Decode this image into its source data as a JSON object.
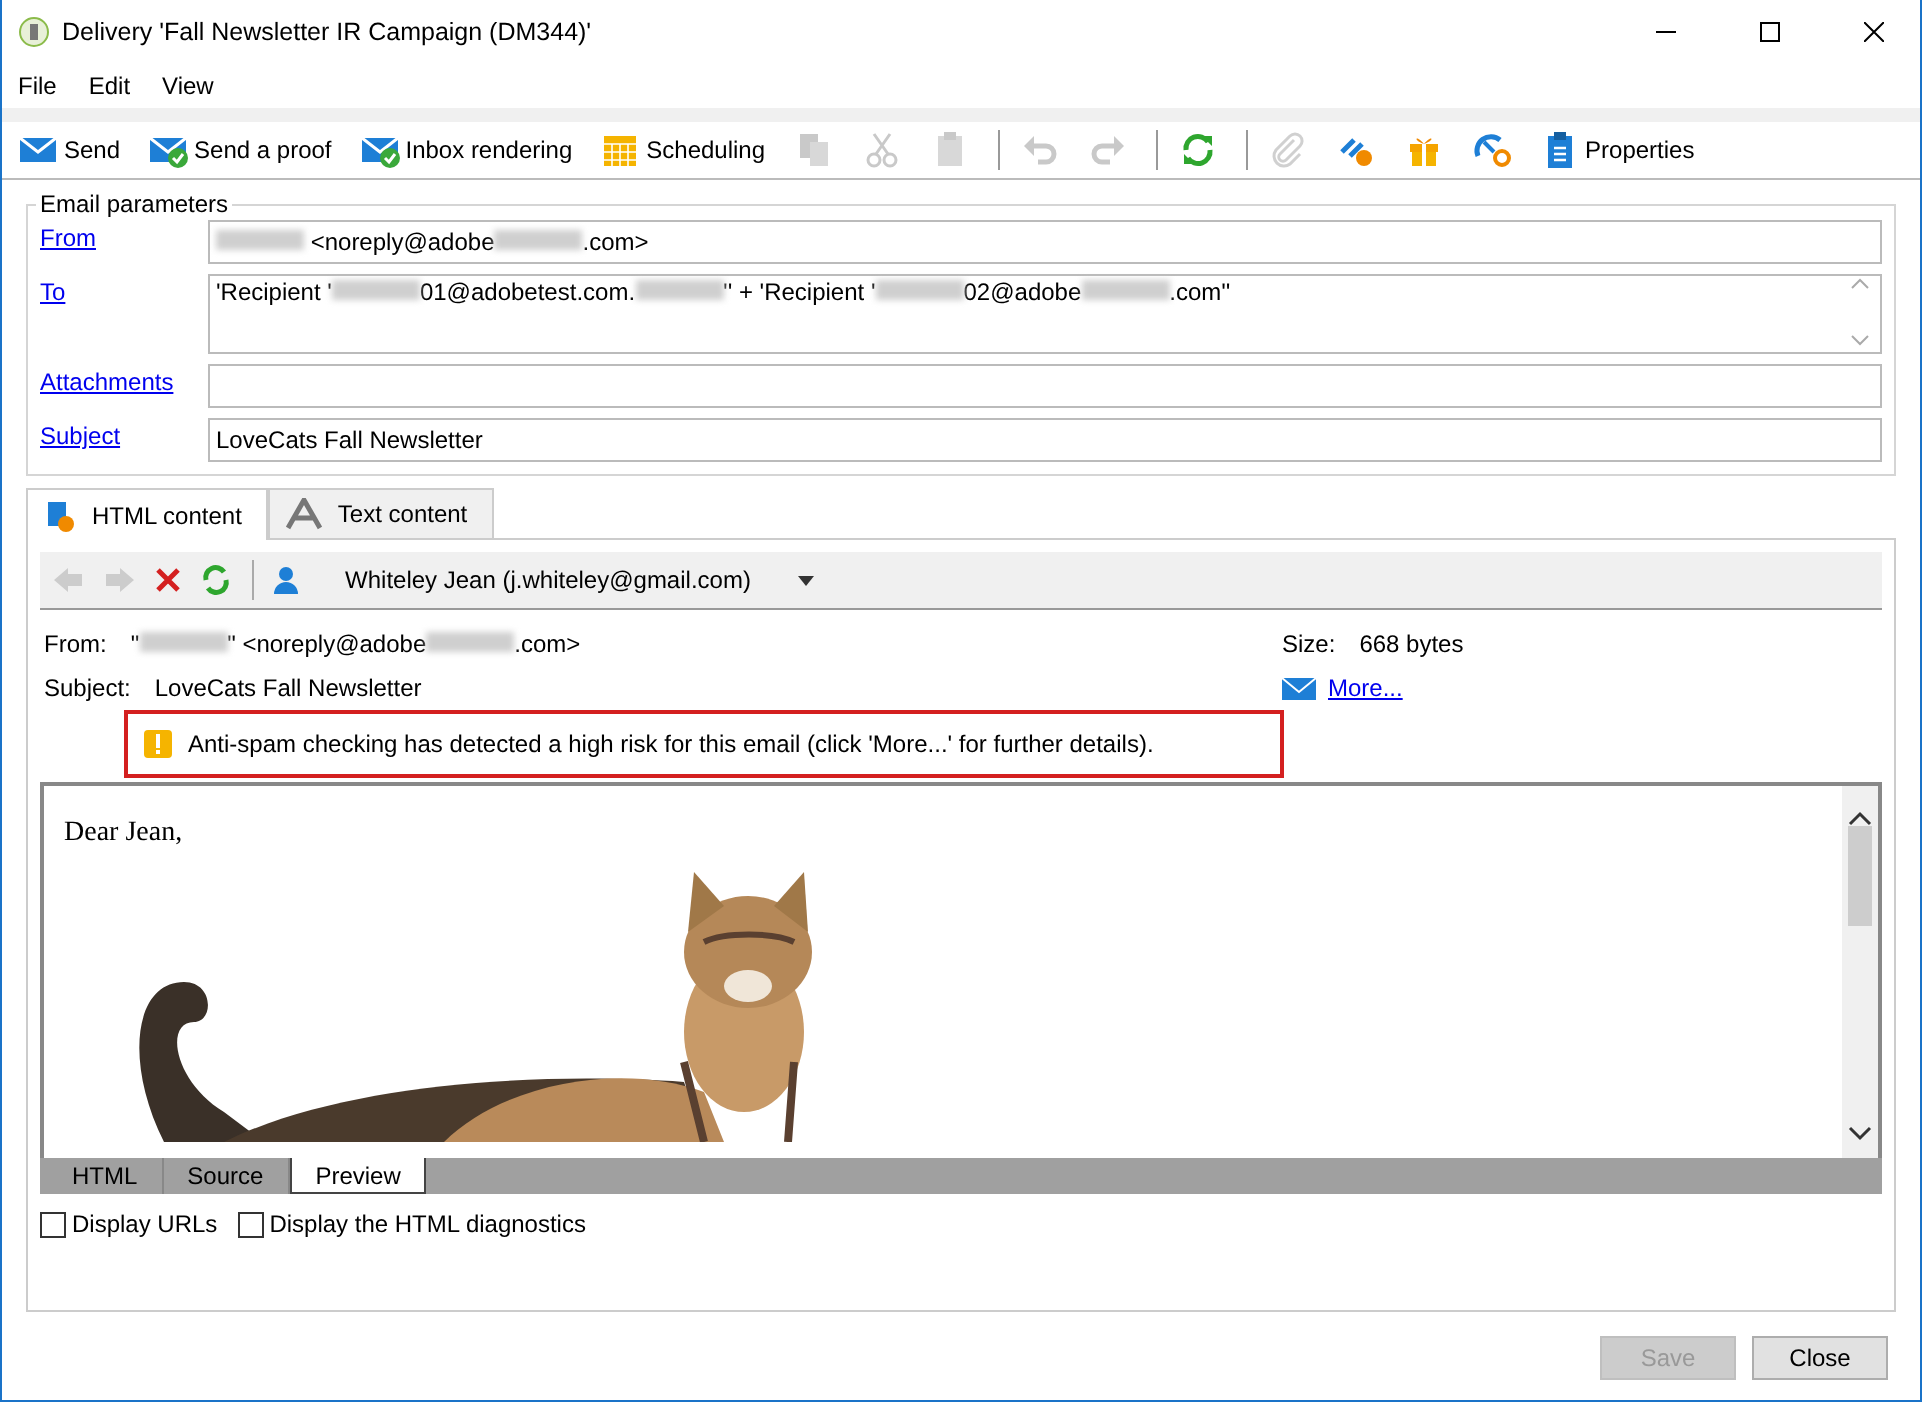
{
  "window": {
    "title": "Delivery 'Fall Newsletter IR Campaign (DM344)'"
  },
  "menu": [
    "File",
    "Edit",
    "View"
  ],
  "toolbar": [
    {
      "kind": "button",
      "label": "Send",
      "disabled": false
    },
    {
      "kind": "button",
      "label": "Send a proof",
      "disabled": false
    },
    {
      "kind": "button",
      "label": "Inbox rendering",
      "disabled": false
    },
    {
      "kind": "button",
      "label": "Scheduling",
      "disabled": false
    },
    {
      "kind": "icon",
      "disabled": true
    },
    {
      "kind": "icon",
      "disabled": true
    },
    {
      "kind": "icon",
      "disabled": true
    },
    {
      "kind": "separator"
    },
    {
      "kind": "icon",
      "disabled": true
    },
    {
      "kind": "icon",
      "disabled": true
    },
    {
      "kind": "separator"
    },
    {
      "kind": "icon",
      "disabled": false
    },
    {
      "kind": "separator"
    },
    {
      "kind": "icon",
      "disabled": true
    },
    {
      "kind": "icon",
      "disabled": false
    },
    {
      "kind": "icon",
      "disabled": false
    },
    {
      "kind": "icon",
      "disabled": false
    },
    {
      "kind": "button",
      "label": "Properties",
      "disabled": false
    }
  ],
  "email_parameters": {
    "title": "Email parameters",
    "fields": [
      {
        "label": "From",
        "value": [
          {
            "kind": "redacted"
          },
          {
            "kind": "text",
            "text": " <noreply@adobe"
          },
          {
            "kind": "redacted"
          },
          {
            "kind": "text",
            "text": ".com>"
          }
        ]
      },
      {
        "label": "To",
        "multiline": true,
        "value": [
          {
            "kind": "text",
            "text": "'Recipient '"
          },
          {
            "kind": "redacted"
          },
          {
            "kind": "text",
            "text": "01@adobetest.com."
          },
          {
            "kind": "redacted"
          },
          {
            "kind": "text",
            "text": "'' + 'Recipient '"
          },
          {
            "kind": "redacted"
          },
          {
            "kind": "text",
            "text": "02@adobe"
          },
          {
            "kind": "redacted"
          },
          {
            "kind": "text",
            "text": ".com''"
          }
        ]
      },
      {
        "label": "Attachments"
      },
      {
        "label": "Subject",
        "value": [
          {
            "kind": "text",
            "text": "LoveCats Fall Newsletter"
          }
        ]
      }
    ]
  },
  "content_tabs": [
    {
      "label": "HTML content",
      "selected": true
    },
    {
      "label": "Text content",
      "selected": false
    }
  ],
  "preview_toolbar": {
    "recipient": "Whiteley Jean (j.whiteley@gmail.com)"
  },
  "preview_header": {
    "from_label": "From:",
    "from": [
      {
        "kind": "text",
        "text": "\""
      },
      {
        "kind": "redacted"
      },
      {
        "kind": "text",
        "text": "\" <noreply@adobe"
      },
      {
        "kind": "redacted"
      },
      {
        "kind": "text",
        "text": ".com>"
      }
    ],
    "subject_label": "Subject:",
    "subject": "LoveCats Fall Newsletter",
    "size_label": "Size:",
    "size": "668 bytes",
    "more_link": "More...",
    "warning": "Anti-spam checking has detected a high risk for this email (click 'More...' for further details)."
  },
  "preview": {
    "greeting": "Dear Jean,"
  },
  "view_tabs": [
    {
      "label": "HTML",
      "selected": false
    },
    {
      "label": "Source",
      "selected": false
    },
    {
      "label": "Preview",
      "selected": true
    }
  ],
  "options": [
    {
      "label": "Display URLs",
      "checked": false
    },
    {
      "label": "Display the HTML diagnostics",
      "checked": false
    }
  ],
  "buttons": [
    {
      "label": "Save",
      "disabled": true
    },
    {
      "label": "Close",
      "disabled": false
    }
  ]
}
